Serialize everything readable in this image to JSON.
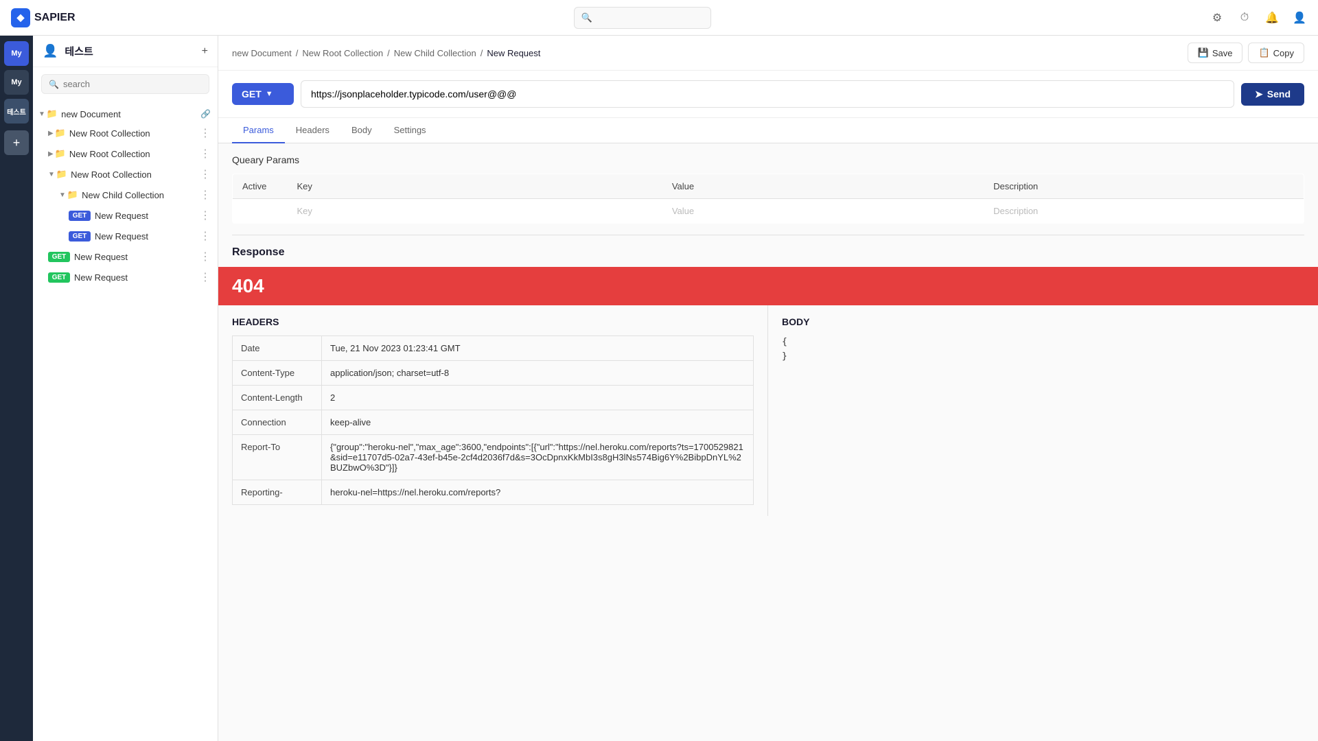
{
  "app": {
    "name": "SAPIER",
    "logo_letter": "◆"
  },
  "topbar": {
    "search_placeholder": "",
    "icons": [
      "gear-icon",
      "history-icon",
      "bell-icon",
      "user-icon"
    ]
  },
  "icon_bar": {
    "buttons": [
      {
        "label": "My",
        "active": true
      },
      {
        "label": "My",
        "active": false
      }
    ],
    "workspace_label": "테스트",
    "add_label": "+"
  },
  "sidebar": {
    "title": "테스트",
    "search_placeholder": "search",
    "tree": {
      "root_label": "new Document",
      "collections": [
        {
          "name": "New Root Collection",
          "level": 1,
          "children": []
        },
        {
          "name": "New Root Collection",
          "level": 1,
          "children": []
        },
        {
          "name": "New Root Collection",
          "level": 1,
          "children": [
            {
              "name": "New Child Collection",
              "level": 2,
              "requests": [
                {
                  "method": "GET",
                  "name": "New Request"
                },
                {
                  "method": "GET",
                  "name": "New Request"
                }
              ]
            }
          ]
        }
      ],
      "loose_requests": [
        {
          "method": "GET",
          "name": "New Request"
        },
        {
          "method": "GET",
          "name": "New Request"
        }
      ]
    }
  },
  "breadcrumb": {
    "path": [
      "new Document",
      "New Root Collection",
      "New Child Collection"
    ],
    "current": "New Request",
    "separator": "/",
    "save_label": "Save",
    "copy_label": "Copy"
  },
  "request": {
    "method": "GET",
    "url": "https://jsonplaceholder.typicode.com/user@@@",
    "send_label": "Send"
  },
  "tabs": {
    "items": [
      "Params",
      "Headers",
      "Body",
      "Settings"
    ],
    "active": "Params"
  },
  "params": {
    "section_title": "Queary Params",
    "columns": [
      "Active",
      "Key",
      "Value",
      "Description"
    ],
    "placeholder_row": {
      "key": "Key",
      "value": "Value",
      "description": "Description"
    }
  },
  "response": {
    "title": "Response",
    "status_code": "404",
    "headers_title": "HEADERS",
    "body_title": "BODY",
    "headers": [
      {
        "key": "Date",
        "value": "Tue, 21 Nov 2023 01:23:41 GMT"
      },
      {
        "key": "Content-Type",
        "value": "application/json; charset=utf-8"
      },
      {
        "key": "Content-Length",
        "value": "2"
      },
      {
        "key": "Connection",
        "value": "keep-alive"
      },
      {
        "key": "Report-To",
        "value": "{\"group\":\"heroku-nel\",\"max_age\":3600,\"endpoints\":[{\"url\":\"https://nel.heroku.com/reports?ts=1700529821&sid=e11707d5-02a7-43ef-b45e-2cf4d2036f7d&s=3OcDpnxKkMbI3s8gH3lNs574Big6Y%2BibpDnYL%2BUZbwO%3D\"}]}"
      },
      {
        "key": "Reporting-",
        "value": "heroku-nel=https://nel.heroku.com/reports?"
      }
    ],
    "body_content": "{\n}"
  }
}
